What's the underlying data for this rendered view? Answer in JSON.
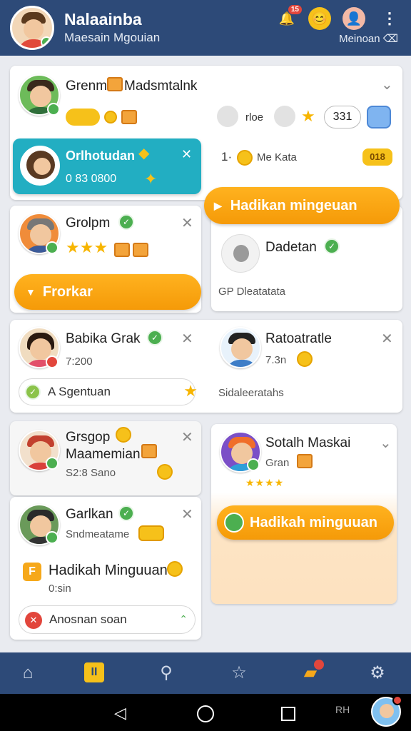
{
  "header": {
    "title": "Nalaainba",
    "subtitle": "Maesain Mgouian",
    "notif_count": "15",
    "right_sub": "Meinoan ⌫"
  },
  "card1": {
    "name": "Grenm",
    "name2": "Madsmtalnk",
    "chip_label": "rloe",
    "count": "331"
  },
  "card_teal": {
    "title": "Orlhotudan",
    "value": "0 83 0800"
  },
  "card_row_r1": {
    "prefix": "1·",
    "label": "Me Kata",
    "badge": "018"
  },
  "card2": {
    "name": "Grolpm",
    "button": "Frorkar"
  },
  "card2r": {
    "button": "Hadikan mingeuan",
    "name": "Dadetan",
    "meta": "GP Dleatatata"
  },
  "card3": {
    "name": "Babika Grak",
    "meta": "7:200",
    "field": "A Sgentuan"
  },
  "card3r": {
    "name": "Ratoatratle",
    "meta": "7.3n",
    "meta2": "Sidaleeratahs"
  },
  "card4": {
    "name": "Grsgop",
    "name2": "Maamemian",
    "meta": "S2:8 Sano"
  },
  "card4r": {
    "name": "Sotalh Maskai",
    "meta": "Gran",
    "button": "Hadikah minguuan"
  },
  "card5": {
    "name": "Garlkan",
    "meta": "Sndmeatame",
    "title": "Hadikah Minguuan",
    "meta2": "0:sin",
    "field": "Anosnan soan"
  },
  "sys": {
    "tag": "RH"
  }
}
